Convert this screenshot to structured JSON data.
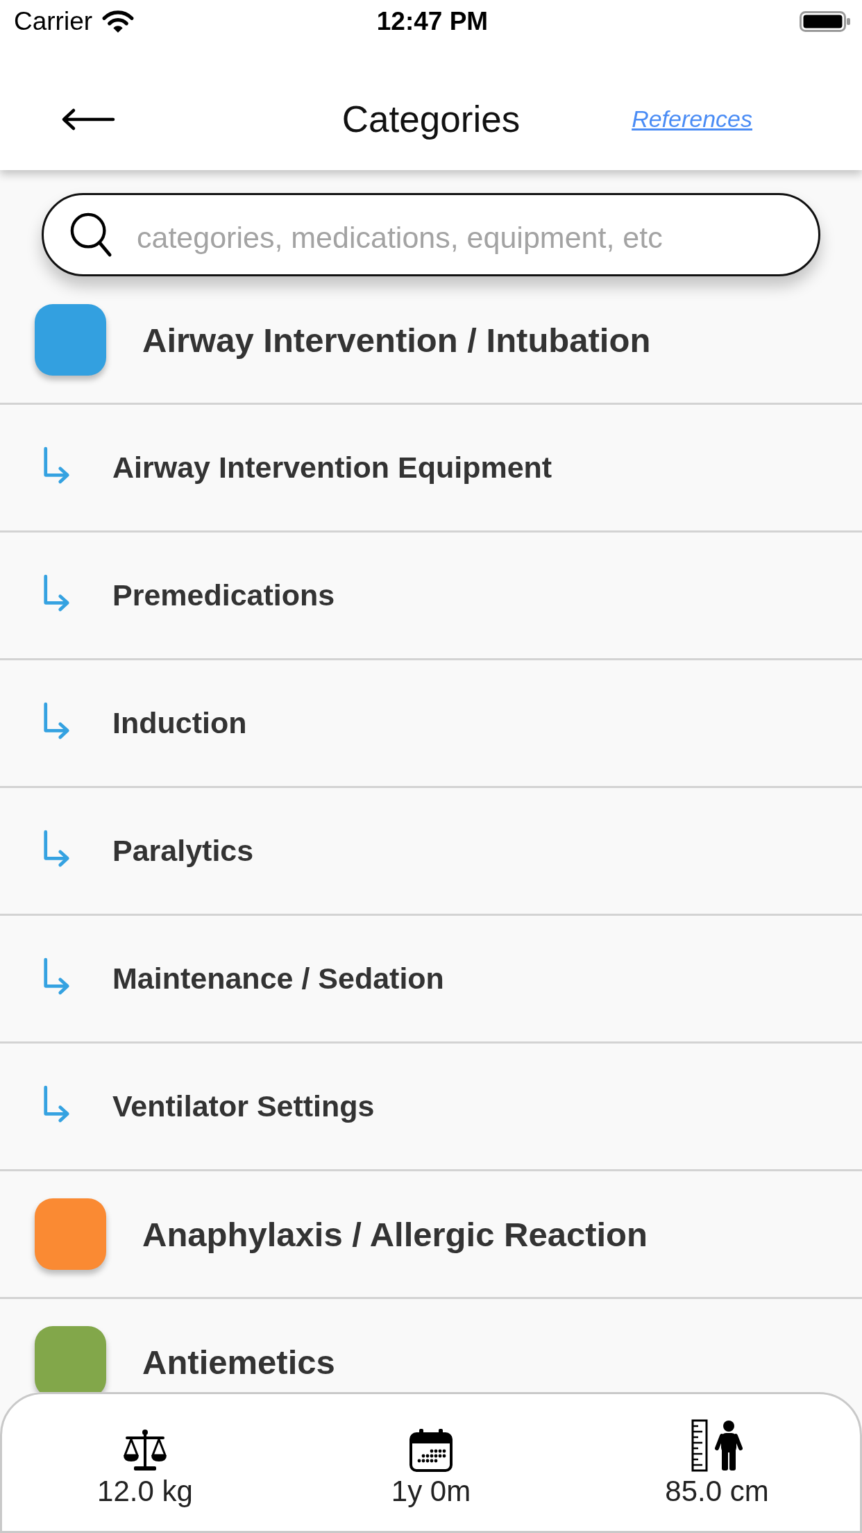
{
  "status_bar": {
    "carrier": "Carrier",
    "time": "12:47 PM"
  },
  "header": {
    "title": "Categories",
    "link": "References"
  },
  "search": {
    "placeholder": "categories, medications, equipment, etc"
  },
  "categories": [
    {
      "label": "Airway Intervention / Intubation",
      "color": "#33a0e0",
      "children": [
        {
          "label": "Airway Intervention Equipment"
        },
        {
          "label": "Premedications"
        },
        {
          "label": "Induction"
        },
        {
          "label": "Paralytics"
        },
        {
          "label": "Maintenance / Sedation"
        },
        {
          "label": "Ventilator Settings"
        }
      ]
    },
    {
      "label": "Anaphylaxis / Allergic Reaction",
      "color": "#fa8a33"
    },
    {
      "label": "Antiemetics",
      "color": "#82a74a"
    }
  ],
  "patient": [
    {
      "kind": "weight",
      "value": "12.0 kg"
    },
    {
      "kind": "age",
      "value": "1y 0m"
    },
    {
      "kind": "height",
      "value": "85.0 cm"
    }
  ]
}
